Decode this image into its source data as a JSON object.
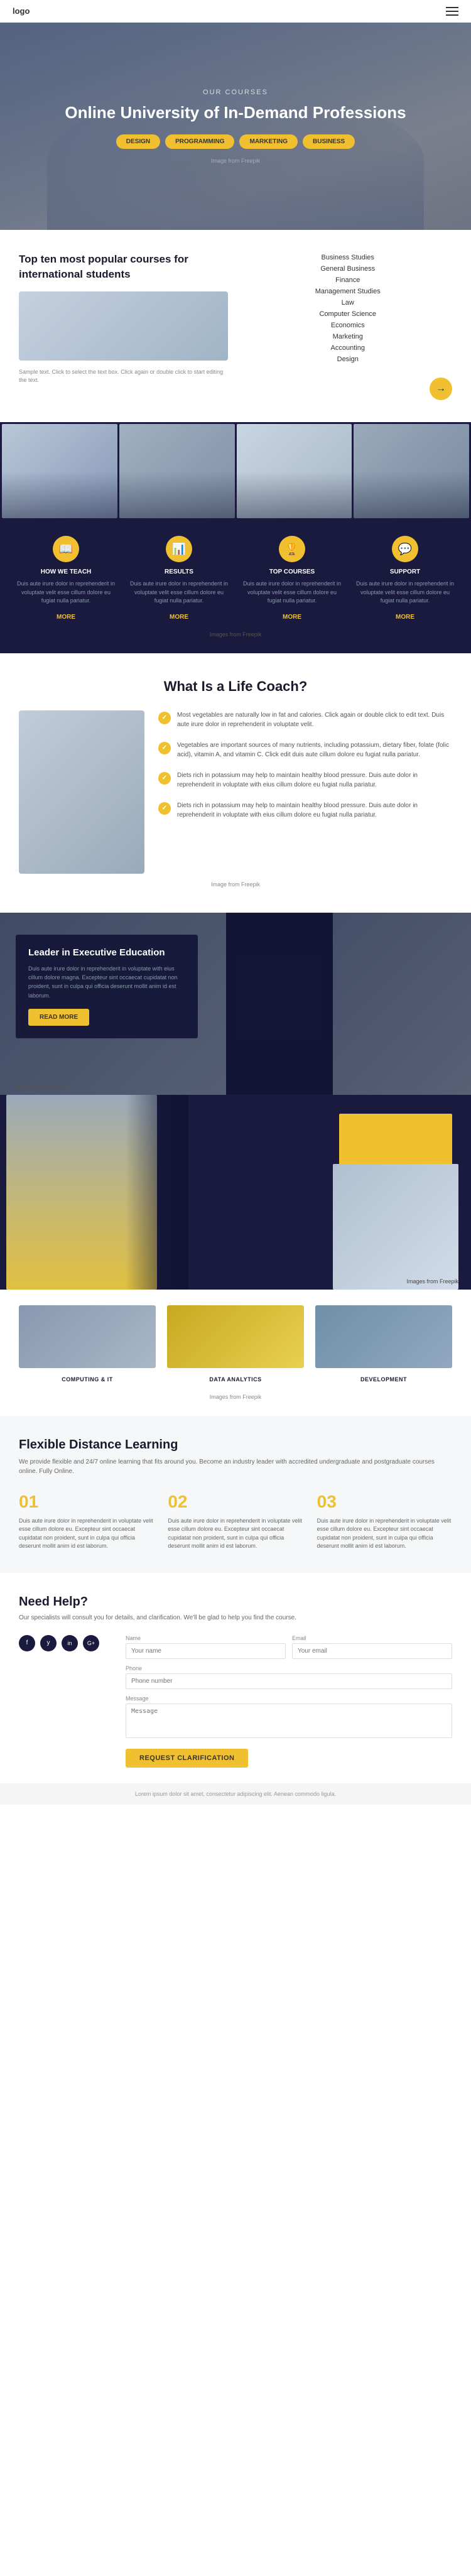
{
  "header": {
    "logo": "logo",
    "menu_icon_label": "menu"
  },
  "hero": {
    "title": "Online University of In-Demand Professions",
    "subtitle": "Our Courses",
    "buttons": [
      "DESIGN",
      "PROGRAMMING",
      "MARKETING",
      "BUSINESS"
    ],
    "credit": "Image from Freepik"
  },
  "popular": {
    "heading": "Top ten most popular courses for international students",
    "sample_text": "Sample text. Click to select the text box. Click again or double click to start editing the text.",
    "courses": [
      "Business Studies",
      "General Business",
      "Finance",
      "Management Studies",
      "Law",
      "Computer Science",
      "Economics",
      "Marketing",
      "Accounting",
      "Design"
    ]
  },
  "stats": {
    "items": [
      {
        "id": "how-we-teach",
        "title": "HOW WE TEACH",
        "desc": "Duis aute irure dolor in reprehenderit in voluptate velit esse cillum dolore eu fugiat nulla pariatur.",
        "more": "MORE",
        "icon": "📖"
      },
      {
        "id": "results",
        "title": "RESULTS",
        "desc": "Duis aute irure dolor in reprehenderit in voluptate velit esse cillum dolore eu fugiat nulla pariatur.",
        "more": "MORE",
        "icon": "📊"
      },
      {
        "id": "top-courses",
        "title": "TOP COURSES",
        "desc": "Duis aute irure dolor in reprehenderit in voluptate velit esse cillum dolore eu fugiat nulla pariatur.",
        "more": "MORE",
        "icon": "🏆"
      },
      {
        "id": "support",
        "title": "SUPPORT",
        "desc": "Duis aute irure dolor in reprehenderit in voluptate velit esse cillum dolore eu fugiat nulla pariatur.",
        "more": "MORE",
        "icon": "💬"
      }
    ],
    "credit": "Images from Freepik"
  },
  "life_coach": {
    "heading": "What Is a Life Coach?",
    "points": [
      "Most vegetables are naturally low in fat and calories. Click again or double click to edit text. Duis aute irure dolor in reprehenderit in voluptate velit.",
      "Vegetables are important sources of many nutrients, including potassium, dietary fiber, folate (folic acid), vitamin A, and vitamin C. Click edit duis aute cillum dolore eu fugiat nulla pariatur.",
      "Diets rich in potassium may help to maintain healthy blood pressure. Duis aute dolor in reprehenderit in voluptate with eius cillum dolore eu fugiat nulla pariatur.",
      "Diets rich in potassium may help to maintain healthy blood pressure. Duis aute dolor in reprehenderit in voluptate with eius cillum dolore eu fugiat nulla pariatur."
    ],
    "credit": "Image from Freepik"
  },
  "leader": {
    "heading": "Leader in Executive Education",
    "description": "Duis aute irure dolor in reprehenderit in voluptate with eius cillum dolore magna. Excepteur sint occaecat cupidatat non proident, sunt in culpa qui officia deserunt mollit anim id est laborum.",
    "credit": "Images from Freepik",
    "button": "READ MORE"
  },
  "categories": {
    "items": [
      {
        "id": "computing",
        "label": "COMPUTING & IT",
        "img_class": "cat-img-computing"
      },
      {
        "id": "data",
        "label": "DATA ANALYTICS",
        "img_class": "cat-img-data"
      },
      {
        "id": "development",
        "label": "DEVELOPMENT",
        "img_class": "cat-img-dev"
      }
    ],
    "credit": "Images from Freepik"
  },
  "flexible": {
    "heading": "Flexible Distance Learning",
    "subtitle": "We provide flexible and 24/7 online learning that fits around you. Become an industry leader with accredited undergraduate and postgraduate courses online. Fully Online.",
    "steps": [
      {
        "num": "01",
        "text": "Duis aute irure dolor in reprehenderit in voluptate velit esse cillum dolore eu. Excepteur sint occaecat cupidatat non proident, sunt in culpa qui officia deserunt mollit anim id est laborum."
      },
      {
        "num": "02",
        "text": "Duis aute irure dolor in reprehenderit in voluptate velit esse cillum dolore eu. Excepteur sint occaecat cupidatat non proident, sunt in culpa qui officia deserunt mollit anim id est laborum."
      },
      {
        "num": "03",
        "text": "Duis aute irure dolor in reprehenderit in voluptate velit esse cillum dolore eu. Excepteur sint occaecat cupidatat non proident, sunt in culpa qui officia deserunt mollit anim id est laborum."
      }
    ]
  },
  "help": {
    "heading": "Need Help?",
    "subtitle": "Our specialists will consult you for details, and clarification. We'll be glad to help you find the course.",
    "socials": [
      "f",
      "y",
      "in",
      "G+"
    ],
    "form": {
      "name_label": "Name",
      "name_placeholder": "Your name",
      "phone_label": "Phone",
      "phone_placeholder": "Phone number",
      "email_label": "Email",
      "email_placeholder": "Your email",
      "message_label": "Message",
      "message_placeholder": "Message",
      "button": "REQUEST CLARIFICATION"
    }
  },
  "footer": {
    "text": "Lorem ipsum dolor sit amet, consectetur adipiscing elit. Aenean commodo ligula."
  }
}
